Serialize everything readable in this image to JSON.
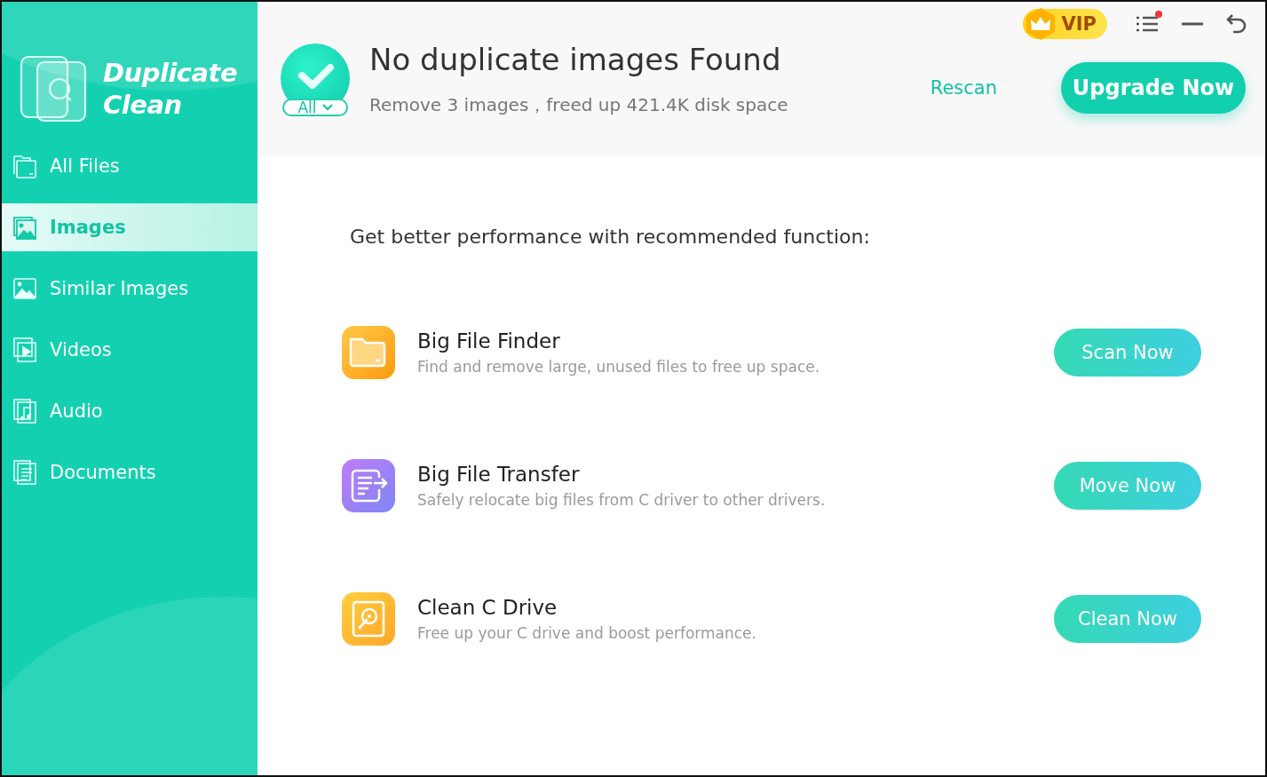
{
  "app": {
    "name_line_1": "Duplicate",
    "name_line_2": "Clean"
  },
  "sidebar": {
    "items": [
      {
        "label": "All Files",
        "kind": "files",
        "selected": false
      },
      {
        "label": "Images",
        "kind": "images",
        "selected": true
      },
      {
        "label": "Similar Images",
        "kind": "image",
        "selected": false
      },
      {
        "label": "Videos",
        "kind": "videos",
        "selected": false
      },
      {
        "label": "Audio",
        "kind": "audio",
        "selected": false
      },
      {
        "label": "Documents",
        "kind": "documents",
        "selected": false
      }
    ]
  },
  "titlebar": {
    "vip_label": "VIP",
    "menu_notification": true
  },
  "result": {
    "title": "No duplicate images Found",
    "summary": "Remove 3 images，freed up 421.4K disk space",
    "filter": "All",
    "rescan": "Rescan",
    "upgrade": "Upgrade Now"
  },
  "recommend": {
    "heading": "Get better performance with recommended function:",
    "features": [
      {
        "kind": "folder",
        "title": "Big File Finder",
        "description": "Find and remove large, unused files to free up space.",
        "button": "Scan Now"
      },
      {
        "kind": "transfer",
        "title": "Big File Transfer",
        "description": "Safely relocate big files from C driver to other drivers.",
        "button": "Move Now"
      },
      {
        "kind": "drive",
        "title": "Clean C Drive",
        "description": "Free up your C drive and boost performance.",
        "button": "Clean Now"
      }
    ]
  }
}
